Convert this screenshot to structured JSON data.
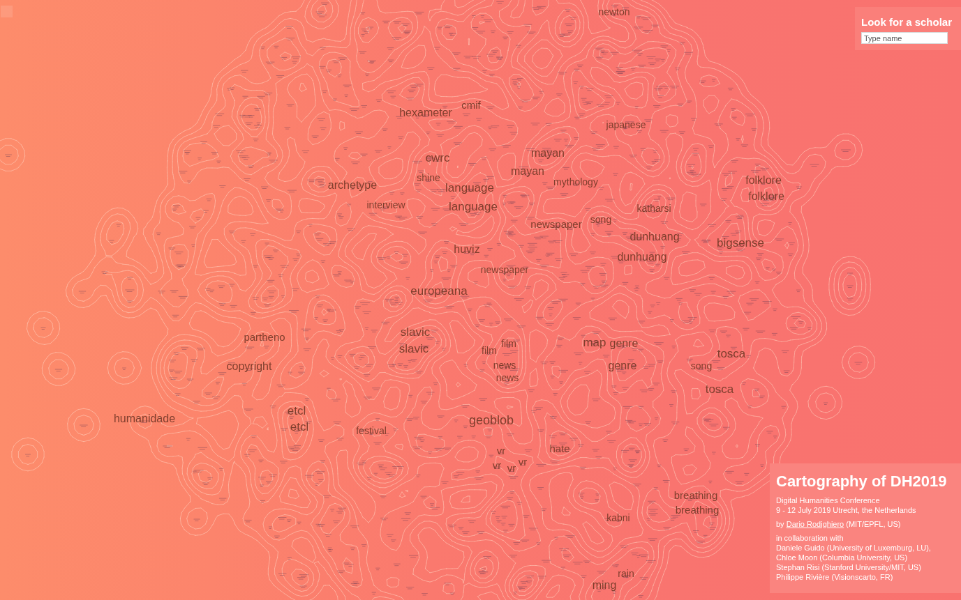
{
  "map": {
    "keywords": [
      "newton",
      "cmif",
      "hexameter",
      "japanese",
      "mayan",
      "cwrc",
      "mayan",
      "shine",
      "mythology",
      "folklore",
      "archetype",
      "language",
      "folklore",
      "interview",
      "language",
      "katharsi",
      "song",
      "newspaper",
      "dunhuang",
      "bigsense",
      "huviz",
      "dunhuang",
      "newspaper",
      "europeana",
      "slavic",
      "partheno",
      "film",
      "map",
      "genre",
      "slavic",
      "film",
      "tosca",
      "copyright",
      "news",
      "genre",
      "song",
      "news",
      "tosca",
      "etcl",
      "humanidade",
      "geoblob",
      "etcl",
      "festival",
      "vr",
      "hate",
      "vr",
      "vr",
      "vr",
      "breathing",
      "breathing",
      "kabni",
      "rain",
      "ming"
    ]
  },
  "scholar_search": {
    "title": "Look for a scholar",
    "placeholder": "Type name"
  },
  "info_panel": {
    "title": "Cartography of DH2019",
    "event_lines": [
      "Digital Humanities Conference",
      "9 - 12 July 2019 Utrecht, the Netherlands"
    ],
    "byline": {
      "prefix": "by",
      "author": "Dario Rodighiero",
      "suffix": "(MIT/EPFL, US)"
    },
    "collaboration_heading": "in collaboration with",
    "collaborators": [
      "Daniele Guido (University of Luxemburg, LU),",
      "Chloe Moon (Columbia University, US)",
      "Stephan Risi (Stanford University/MIT, US)",
      "Philippe Rivière (Visionscarto, FR)"
    ]
  }
}
